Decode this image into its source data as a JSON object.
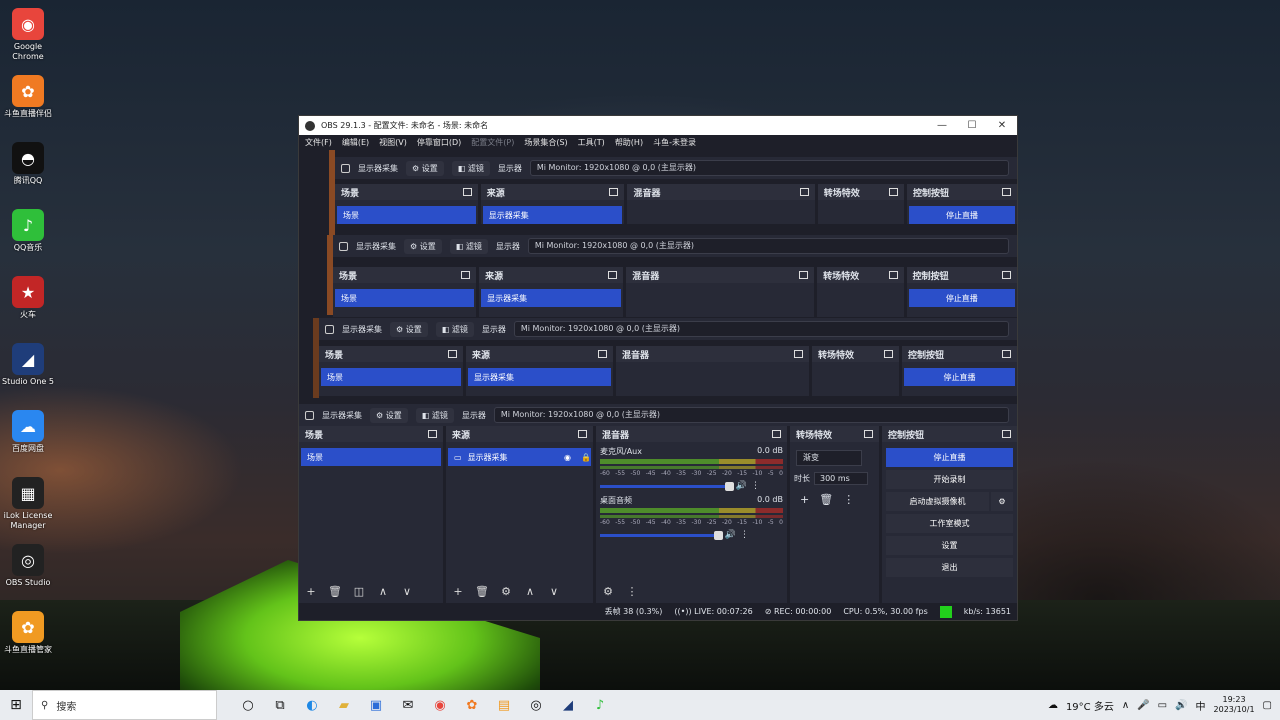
{
  "desktop": {
    "icons": [
      {
        "label": "Google Chrome",
        "icon": "chrome-icon",
        "color": "#e8453c",
        "glyph": "◉"
      },
      {
        "label": "斗鱼直播伴侣",
        "icon": "douyu-icon",
        "color": "#f07a22",
        "glyph": "✿"
      },
      {
        "label": "腾讯QQ",
        "icon": "qq-icon",
        "color": "#111111",
        "glyph": "◓"
      },
      {
        "label": "QQ音乐",
        "icon": "qqmusic-icon",
        "color": "#2fbf3a",
        "glyph": "♪"
      },
      {
        "label": "火车",
        "icon": "star-icon",
        "color": "#c22626",
        "glyph": "★"
      },
      {
        "label": "Studio One 5",
        "icon": "studio-one-icon",
        "color": "#1f3d7a",
        "glyph": "◢"
      },
      {
        "label": "百度网盘",
        "icon": "baidu-netdisk-icon",
        "color": "#2a87f0",
        "glyph": "☁"
      },
      {
        "label": "iLok License Manager",
        "icon": "ilok-icon",
        "color": "#222222",
        "glyph": "▦"
      },
      {
        "label": "OBS Studio",
        "icon": "obs-icon",
        "color": "#222222",
        "glyph": "◎"
      },
      {
        "label": "斗鱼直播管家",
        "icon": "douyu-manager-icon",
        "color": "#f09a22",
        "glyph": "✿"
      }
    ]
  },
  "obs": {
    "title": "OBS 29.1.3 - 配置文件: 未命名 - 场景: 未命名",
    "menu": [
      {
        "label": "文件(F)",
        "dim": false
      },
      {
        "label": "编辑(E)",
        "dim": false
      },
      {
        "label": "视图(V)",
        "dim": false
      },
      {
        "label": "停靠窗口(D)",
        "dim": false
      },
      {
        "label": "配置文件(P)",
        "dim": true
      },
      {
        "label": "场景集合(S)",
        "dim": false
      },
      {
        "label": "工具(T)",
        "dim": false
      },
      {
        "label": "帮助(H)",
        "dim": false
      },
      {
        "label": "斗鱼-未登录",
        "dim": false
      }
    ],
    "source_bar": {
      "source_name": "显示器采集",
      "settings_label": "设置",
      "filters_label": "滤镜",
      "display_label": "显示器",
      "monitor_value": "Mi Monitor: 1920x1080 @ 0,0 (主显示器)"
    },
    "docks": {
      "scenes": {
        "title": "场景",
        "items": [
          "场景"
        ]
      },
      "sources": {
        "title": "来源",
        "items": [
          "显示器采集"
        ]
      },
      "mixer": {
        "title": "混音器",
        "scale": [
          "-60",
          "-55",
          "-50",
          "-45",
          "-40",
          "-35",
          "-30",
          "-25",
          "-20",
          "-15",
          "-10",
          "-5",
          "0"
        ],
        "channels": [
          {
            "name": "麦克风/Aux",
            "db": "0.0 dB",
            "level": 0.72
          },
          {
            "name": "桌面音频",
            "db": "0.0 dB",
            "level": 0.66
          }
        ]
      },
      "transitions": {
        "title": "转场特效",
        "selected": "渐变",
        "duration_label": "时长",
        "duration_value": "300 ms"
      },
      "controls": {
        "title": "控制按钮",
        "buttons": [
          "停止直播",
          "开始录制",
          "启动虚拟摄像机",
          "工作室模式",
          "设置",
          "退出"
        ]
      }
    },
    "status": {
      "dropped": "丢帧 38 (0.3%)",
      "live": "LIVE: 00:07:26",
      "rec": "REC: 00:00:00",
      "cpu": "CPU: 0.5%, 30.00 fps",
      "kbs": "kb/s: 13651"
    }
  },
  "taskbar": {
    "search_placeholder": "搜索",
    "weather": "19°C 多云",
    "ime": "中",
    "time": "19:23",
    "date": "2023/10/1"
  }
}
